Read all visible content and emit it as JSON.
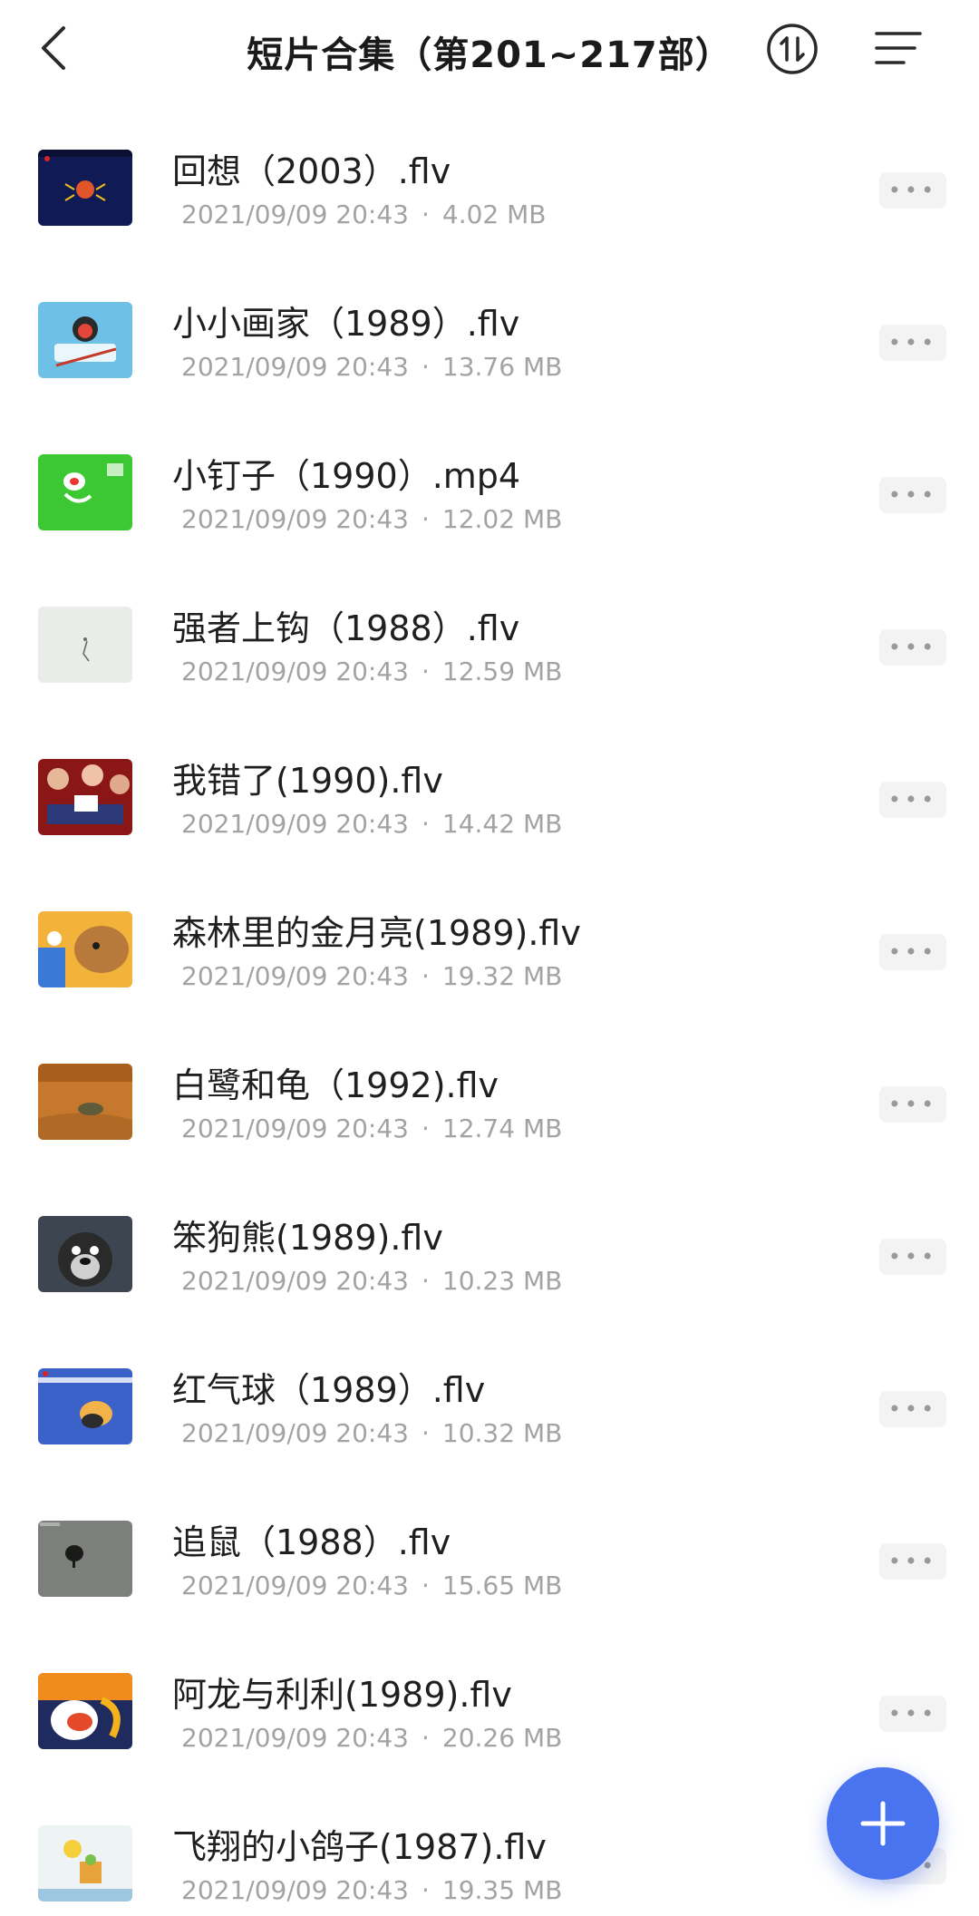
{
  "header": {
    "title": "短片合集（第201~217部）"
  },
  "files": [
    {
      "name": "回想（2003）.flv",
      "date": "2021/09/09 20:43",
      "size": "4.02 MB"
    },
    {
      "name": "小小画家（1989）.flv",
      "date": "2021/09/09 20:43",
      "size": "13.76 MB"
    },
    {
      "name": "小钉子（1990）.mp4",
      "date": "2021/09/09 20:43",
      "size": "12.02 MB"
    },
    {
      "name": "强者上钩（1988）.flv",
      "date": "2021/09/09 20:43",
      "size": "12.59 MB"
    },
    {
      "name": "我错了(1990).flv",
      "date": "2021/09/09 20:43",
      "size": "14.42 MB"
    },
    {
      "name": "森林里的金月亮(1989).flv",
      "date": "2021/09/09 20:43",
      "size": "19.32 MB"
    },
    {
      "name": "白鹭和龟（1992).flv",
      "date": "2021/09/09 20:43",
      "size": "12.74 MB"
    },
    {
      "name": "笨狗熊(1989).flv",
      "date": "2021/09/09 20:43",
      "size": "10.23 MB"
    },
    {
      "name": "红气球（1989）.flv",
      "date": "2021/09/09 20:43",
      "size": "10.32 MB"
    },
    {
      "name": "追鼠（1988）.flv",
      "date": "2021/09/09 20:43",
      "size": "15.65 MB"
    },
    {
      "name": "阿龙与利利(1989).flv",
      "date": "2021/09/09 20:43",
      "size": "20.26 MB"
    },
    {
      "name": "飞翔的小鸽子(1987).flv",
      "date": "2021/09/09 20:43",
      "size": "19.35 MB"
    }
  ],
  "meta_separator": "·",
  "more_label": "•••"
}
